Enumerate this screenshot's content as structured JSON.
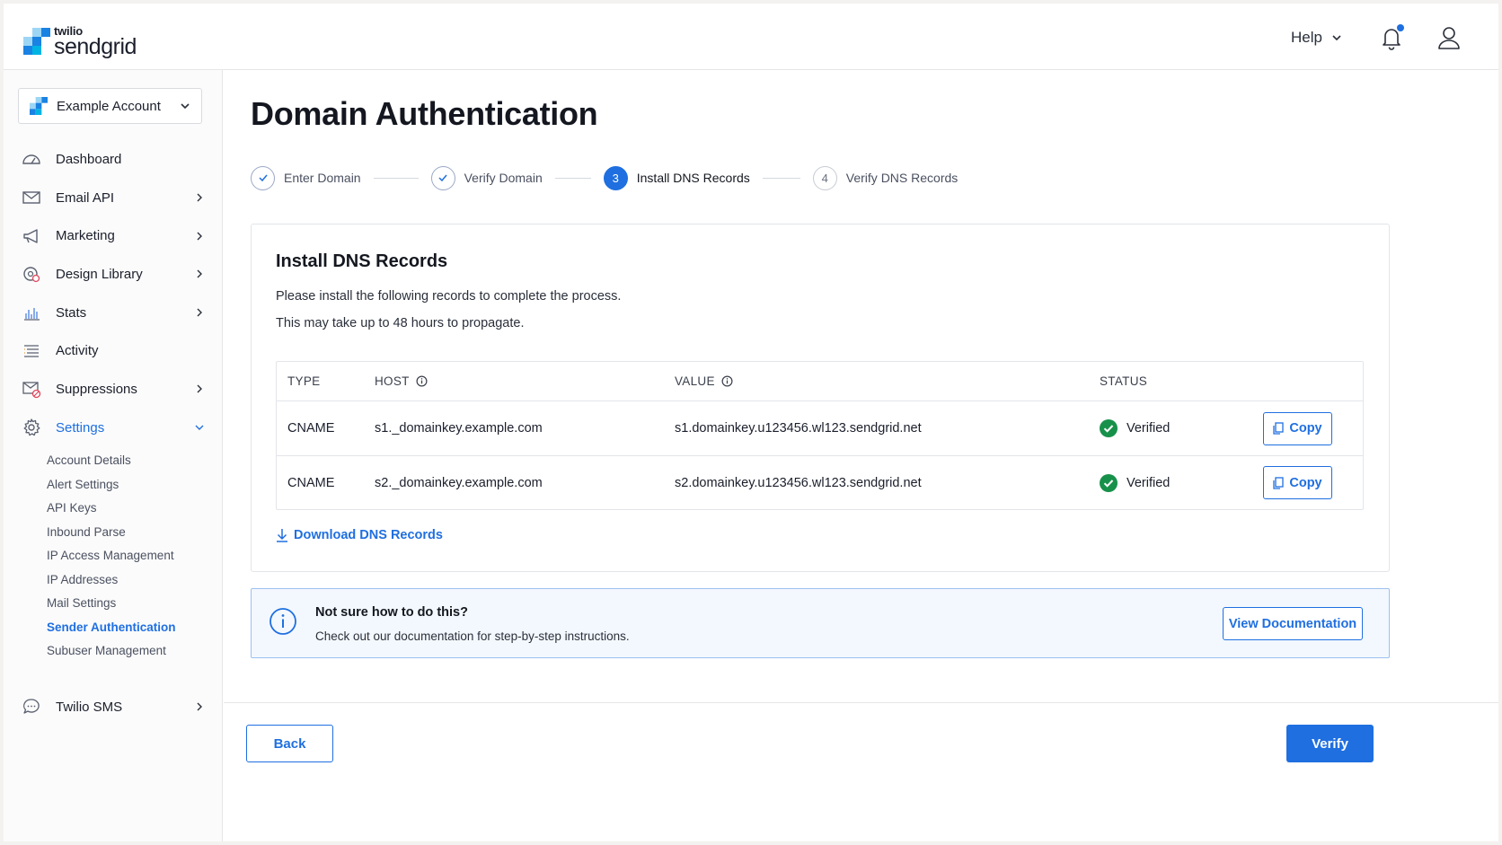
{
  "brand": {
    "top": "twilio",
    "name": "sendgrid",
    "accent": "#1f6fe0"
  },
  "header": {
    "help_label": "Help"
  },
  "account": {
    "name": "Example Account"
  },
  "sidebar": {
    "items": [
      {
        "label": "Dashboard",
        "icon": "dashboard-icon",
        "has_chevron": false
      },
      {
        "label": "Email API",
        "icon": "email-icon",
        "has_chevron": true
      },
      {
        "label": "Marketing",
        "icon": "megaphone-icon",
        "has_chevron": true
      },
      {
        "label": "Design Library",
        "icon": "palette-icon",
        "has_chevron": true
      },
      {
        "label": "Stats",
        "icon": "bar-chart-icon",
        "has_chevron": true
      },
      {
        "label": "Activity",
        "icon": "list-icon",
        "has_chevron": false
      },
      {
        "label": "Suppressions",
        "icon": "suppression-icon",
        "has_chevron": true
      },
      {
        "label": "Settings",
        "icon": "gear-icon",
        "has_chevron": true,
        "expanded": true
      }
    ],
    "settings_sub": [
      "Account Details",
      "Alert Settings",
      "API Keys",
      "Inbound Parse",
      "IP Access Management",
      "IP Addresses",
      "Mail Settings",
      "Sender Authentication",
      "Subuser Management"
    ],
    "active_sub": "Sender Authentication",
    "twilio_sms": "Twilio SMS"
  },
  "page": {
    "title": "Domain Authentication"
  },
  "stepper": {
    "steps": [
      {
        "num": "1",
        "label": "Enter Domain",
        "state": "done"
      },
      {
        "num": "2",
        "label": "Verify Domain",
        "state": "done"
      },
      {
        "num": "3",
        "label": "Install DNS Records",
        "state": "current"
      },
      {
        "num": "4",
        "label": "Verify DNS Records",
        "state": "pending"
      }
    ]
  },
  "card": {
    "title": "Install DNS Records",
    "desc1": "Please install the following records to complete the process.",
    "desc2": "This may take up to 48 hours to propagate.",
    "columns": {
      "type": "TYPE",
      "host": "HOST",
      "value": "VALUE",
      "status": "STATUS"
    },
    "rows": [
      {
        "type": "CNAME",
        "host": "s1._domainkey.example.com",
        "value": "s1.domainkey.u123456.wl123.sendgrid.net",
        "status": "Verified",
        "action": "Copy"
      },
      {
        "type": "CNAME",
        "host": "s2._domainkey.example.com",
        "value": "s2.domainkey.u123456.wl123.sendgrid.net",
        "status": "Verified",
        "action": "Copy"
      }
    ],
    "download_label": "Download DNS Records",
    "status_color": "#17914a"
  },
  "banner": {
    "title": "Not sure how to do this?",
    "text": "Check out our documentation for step-by-step instructions.",
    "button": "View Documentation"
  },
  "footer": {
    "back": "Back",
    "verify": "Verify"
  }
}
